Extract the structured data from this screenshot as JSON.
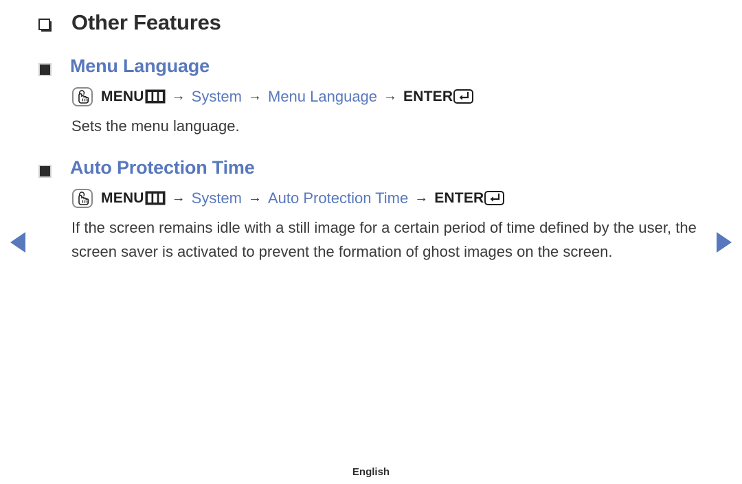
{
  "page": {
    "title": "Other Features",
    "footer_language": "English",
    "accent_color": "#5878bd",
    "text_color": "#3a3a3a"
  },
  "nav": {
    "prev_icon": "triangle-left-icon",
    "next_icon": "triangle-right-icon"
  },
  "icons": {
    "title_bullet": "square-outline-bullet-icon",
    "section_bullet": "square-filled-bullet-icon",
    "hand_press": "hand-press-icon",
    "menu_button": "menu-button-icon",
    "enter_button": "enter-button-icon"
  },
  "sections": [
    {
      "heading": "Menu Language",
      "path": {
        "menu_label": "MENU",
        "arrow": "→",
        "steps": [
          "System",
          "Menu Language"
        ],
        "enter_label": "ENTER"
      },
      "body": "Sets the menu language."
    },
    {
      "heading": "Auto Protection Time",
      "path": {
        "menu_label": "MENU",
        "arrow": "→",
        "steps": [
          "System",
          "Auto Protection Time"
        ],
        "enter_label": "ENTER"
      },
      "body": "If the screen remains idle with a still image for a certain period of time defined by the user, the screen saver is activated to prevent the formation of ghost images on the screen."
    }
  ]
}
